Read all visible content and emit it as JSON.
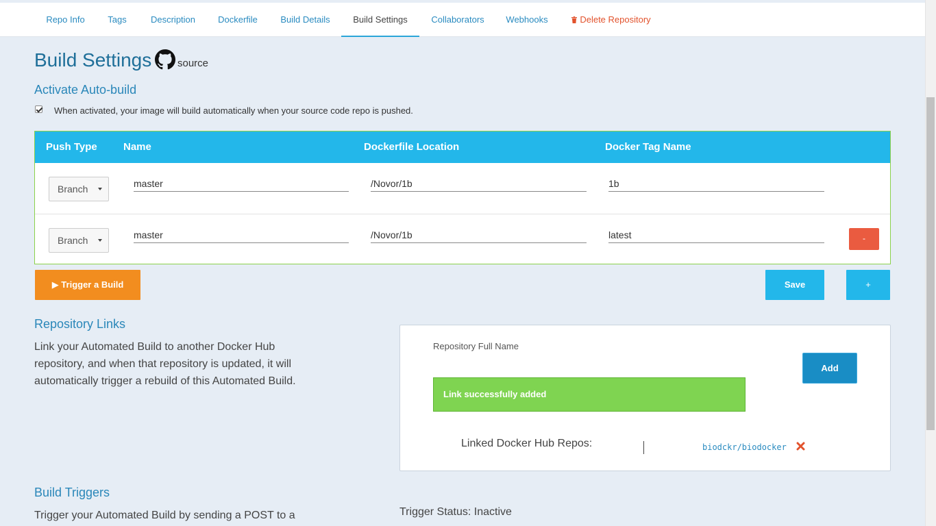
{
  "nav": {
    "tabs": [
      {
        "label": "Repo Info"
      },
      {
        "label": "Tags"
      },
      {
        "label": "Description"
      },
      {
        "label": "Dockerfile"
      },
      {
        "label": "Build Details"
      },
      {
        "label": "Build Settings",
        "active": true
      },
      {
        "label": "Collaborators"
      },
      {
        "label": "Webhooks"
      },
      {
        "label": "Delete Repository",
        "icon": "trash-icon"
      }
    ]
  },
  "page": {
    "title": "Build Settings",
    "source_icon": "github-icon",
    "source_label": "source"
  },
  "autobuild": {
    "heading": "Activate Auto-build",
    "checked": true,
    "description": "When activated, your image will build automatically when your source code repo is pushed."
  },
  "table": {
    "headers": [
      "Push Type",
      "Name",
      "Dockerfile Location",
      "Docker Tag Name"
    ],
    "rows": [
      {
        "push_type": "Branch",
        "name": "master",
        "location": "/Novor/1b",
        "tag": "1b"
      },
      {
        "push_type": "Branch",
        "name": "master",
        "location": "/Novor/1b",
        "tag": "latest",
        "remove_label": "-"
      }
    ]
  },
  "actions": {
    "trigger_label": "▶ Trigger a Build",
    "save_label": "Save",
    "add_row_label": "+"
  },
  "repo_links": {
    "heading": "Repository Links",
    "description": "Link your Automated Build to another Docker Hub repository, and when that repository is updated, it will automatically trigger a rebuild of this Automated Build.",
    "full_name_label": "Repository Full Name",
    "add_label": "Add",
    "success_message": "Link successfully added",
    "linked_label": "Linked Docker Hub Repos:",
    "linked_repos": [
      "biodckr/biodocker"
    ]
  },
  "build_triggers": {
    "heading": "Build Triggers",
    "description": "Trigger your Automated Build by sending a POST to a",
    "status": "Trigger Status: Inactive"
  },
  "colors": {
    "accent": "#23b7ea",
    "trigger": "#f28d1f",
    "danger": "#ea5b40",
    "success": "#7fd451",
    "heading": "#1f6f99"
  }
}
